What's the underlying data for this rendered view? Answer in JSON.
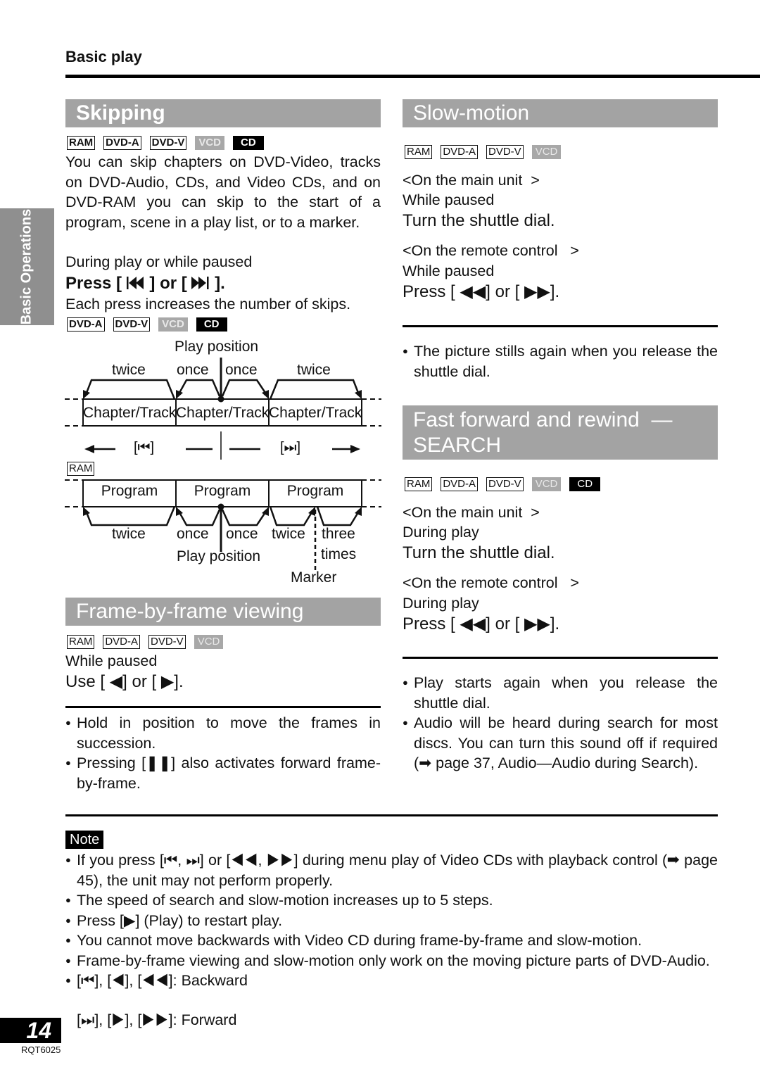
{
  "header": {
    "section": "Basic play"
  },
  "side_tab": "Basic Operations",
  "page": {
    "number": "14",
    "model": "RQT6025"
  },
  "skipping": {
    "title": "Skipping",
    "badges": [
      "RAM",
      "DVD-A",
      "DVD-V",
      "VCD",
      "CD"
    ],
    "description": "You can skip chapters on DVD-Video, tracks on DVD-Audio, CDs, and Video CDs, and on DVD-RAM you can skip to the start of a program, scene in a play list, or to a marker.",
    "condition": "During play or while paused",
    "instruction": "Press [ ⏮ ] or [ ⏭ ].",
    "instruction_parts": {
      "press": "Press [",
      "or": "] or [",
      "end": "]."
    },
    "note": "Each press increases the number of skips.",
    "diagram1": {
      "badges": [
        "DVD-A",
        "DVD-V",
        "VCD",
        "CD"
      ],
      "play_position": "Play position",
      "labels": [
        "twice",
        "once",
        "once",
        "twice"
      ],
      "cells": [
        "Chapter/Track",
        "Chapter/Track",
        "Chapter/Track"
      ],
      "prev_key": "[⏮]",
      "next_key": "[⏭]"
    },
    "diagram2": {
      "badge": "RAM",
      "cells": [
        "Program",
        "Program",
        "Program"
      ],
      "labels": [
        "twice",
        "once",
        "once",
        "twice",
        "three",
        "times"
      ],
      "play_position": "Play position",
      "marker": "Marker"
    }
  },
  "frame_by_frame": {
    "title": "Frame-by-frame viewing",
    "badges": [
      "RAM",
      "DVD-A",
      "DVD-V",
      "VCD"
    ],
    "condition": "While paused",
    "instruction": "Use [ ◀] or [ ▶].",
    "bullets": [
      "Hold in position to move the frames in succession.",
      "Pressing [❚❚] also activates forward frame-by-frame."
    ]
  },
  "slow_motion": {
    "title": "Slow-motion",
    "badges": [
      "RAM",
      "DVD-A",
      "DVD-V",
      "VCD"
    ],
    "main_unit_label": "<On the main unit  >",
    "main_unit_condition": "While paused",
    "main_unit_instruction": "Turn the shuttle dial.",
    "remote_label": "<On the remote control   >",
    "remote_condition": "While paused",
    "remote_instruction": "Press [ ◀◀] or [ ▶▶].",
    "bullets": [
      "The picture stills again when you release the shuttle dial."
    ]
  },
  "search": {
    "title_line1": "Fast forward and rewind  —",
    "title_line2": "SEARCH",
    "badges": [
      "RAM",
      "DVD-A",
      "DVD-V",
      "VCD",
      "CD"
    ],
    "main_unit_label": "<On the main unit  >",
    "main_unit_condition": "During play",
    "main_unit_instruction": "Turn the shuttle dial.",
    "remote_label": "<On the remote control   >",
    "remote_condition": "During play",
    "remote_instruction": "Press [ ◀◀] or [ ▶▶].",
    "bullets": [
      "Play starts again when you release the shuttle dial.",
      "Audio will be heard during search for most discs. You can turn this sound off if required (➡ page 37, Audio—Audio during Search)."
    ]
  },
  "note": {
    "label": "Note",
    "bullets": [
      "If you press [⏮, ⏭] or [◀◀, ▶▶] during menu play of Video CDs with playback control (➡ page 45), the unit may not perform properly.",
      "The speed of search and slow-motion increases up to 5 steps.",
      "Press [▶] (Play) to restart play.",
      "You cannot move backwards with Video CD during frame-by-frame and slow-motion.",
      "Frame-by-frame viewing and slow-motion only work on the moving picture parts of DVD-Audio."
    ],
    "legend_backward": "[⏮], [◀], [◀◀]:  Backward",
    "legend_forward": "[⏭], [▶], [▶▶]:  Forward"
  }
}
